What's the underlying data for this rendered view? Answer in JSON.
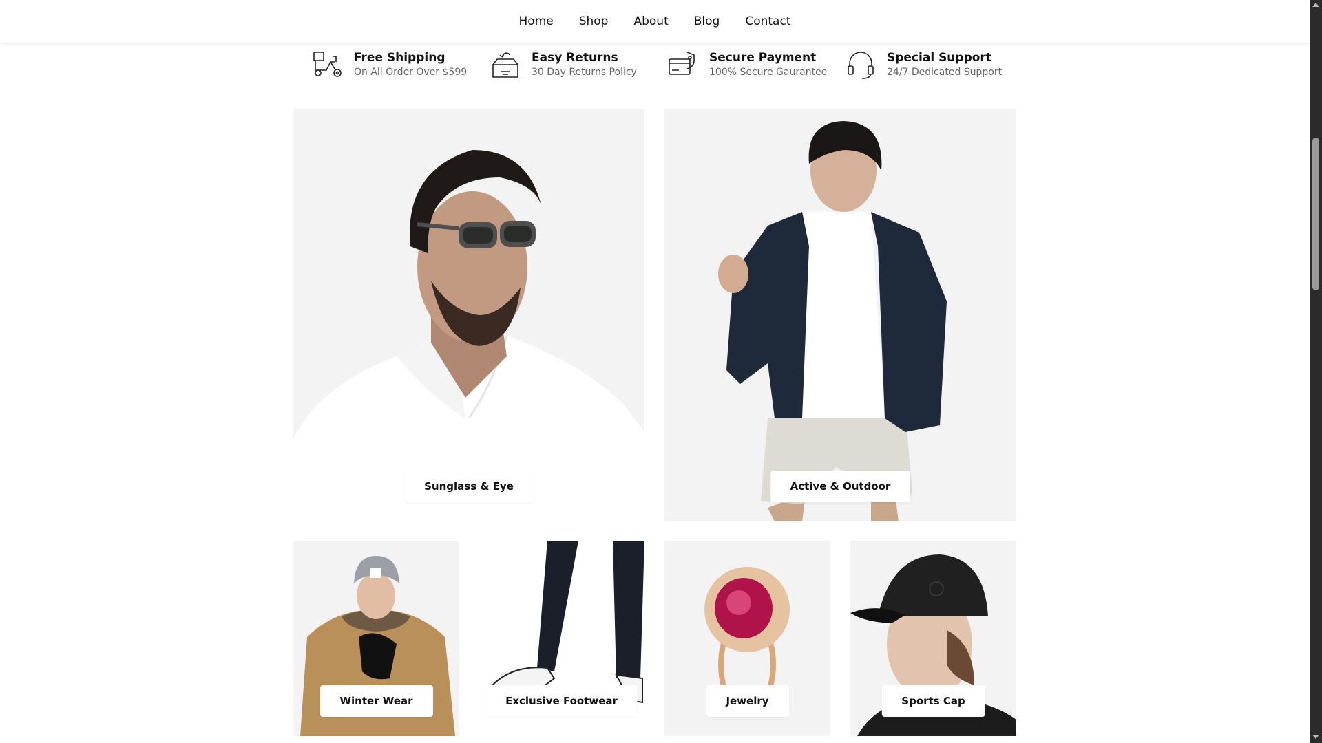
{
  "nav": {
    "items": [
      {
        "label": "Home"
      },
      {
        "label": "Shop"
      },
      {
        "label": "About"
      },
      {
        "label": "Blog"
      },
      {
        "label": "Contact"
      }
    ]
  },
  "features": [
    {
      "icon": "delivery-scooter-icon",
      "title": "Free Shipping",
      "subtitle": "On All Order Over $599"
    },
    {
      "icon": "return-box-icon",
      "title": "Easy Returns",
      "subtitle": "30 Day Returns Policy"
    },
    {
      "icon": "secure-card-icon",
      "title": "Secure Payment",
      "subtitle": "100% Secure Gaurantee"
    },
    {
      "icon": "headset-support-icon",
      "title": "Special Support",
      "subtitle": "24/7 Dedicated Support"
    }
  ],
  "categories": {
    "large": [
      {
        "label": "Sunglass & Eye"
      },
      {
        "label": "Active & Outdoor"
      }
    ],
    "small": [
      {
        "label": "Winter Wear"
      },
      {
        "label": "Exclusive Footwear"
      },
      {
        "label": "Jewelry"
      },
      {
        "label": "Sports Cap"
      }
    ]
  },
  "colors": {
    "background": "#ffffff",
    "tile_background": "#f3f3f3",
    "text": "#111111",
    "muted": "#666666",
    "scrollbar_track": "#2b2b2b"
  }
}
